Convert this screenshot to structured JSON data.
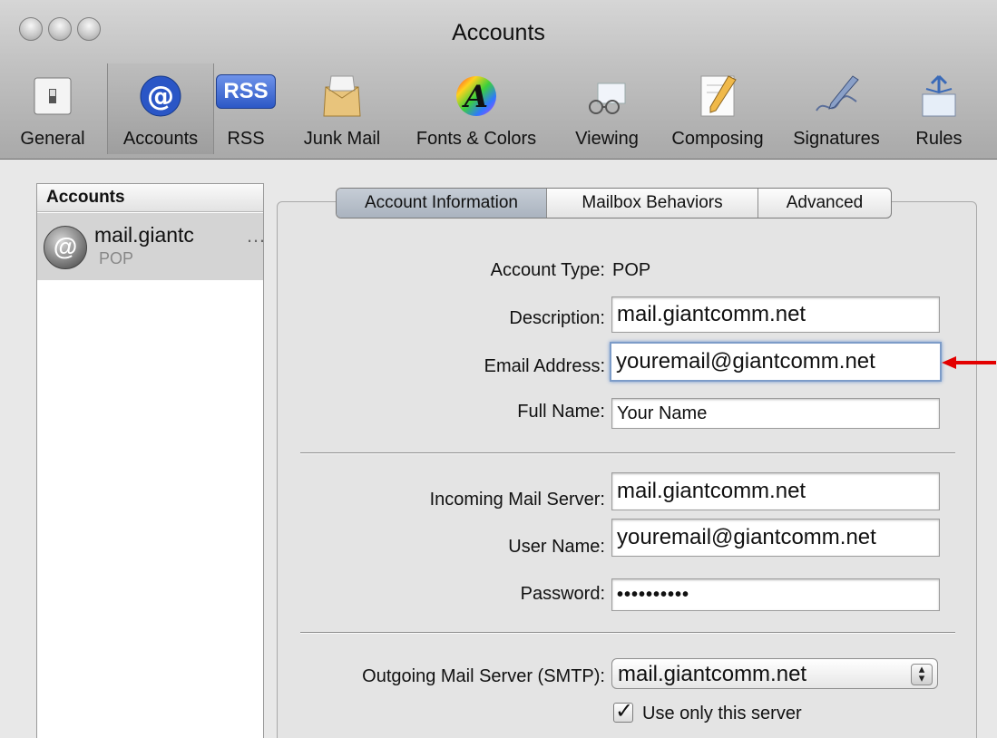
{
  "window": {
    "title": "Accounts"
  },
  "toolbar": {
    "items": [
      {
        "label": "General",
        "icon": "switch-icon"
      },
      {
        "label": "Accounts",
        "icon": "at-icon"
      },
      {
        "label": "RSS",
        "icon": "rss-icon"
      },
      {
        "label": "Junk Mail",
        "icon": "junk-mail-icon"
      },
      {
        "label": "Fonts & Colors",
        "icon": "fonts-colors-icon"
      },
      {
        "label": "Viewing",
        "icon": "viewing-icon"
      },
      {
        "label": "Composing",
        "icon": "composing-icon"
      },
      {
        "label": "Signatures",
        "icon": "signatures-icon"
      },
      {
        "label": "Rules",
        "icon": "rules-icon"
      }
    ],
    "selected": "Accounts",
    "rss_badge": "RSS"
  },
  "sidebar": {
    "header": "Accounts",
    "account_name": "mail.giantc",
    "account_ellipsis": "…",
    "account_type": "POP",
    "avatar_glyph": "@"
  },
  "tabs": [
    "Account Information",
    "Mailbox Behaviors",
    "Advanced"
  ],
  "form": {
    "account_type_label": "Account Type:",
    "account_type_value": "POP",
    "description_label": "Description:",
    "description_value": "mail.giantcomm.net",
    "email_label": "Email Address:",
    "email_value": "youremail@giantcomm.net",
    "full_name_label": "Full Name:",
    "full_name_value": "Your Name",
    "incoming_label": "Incoming Mail Server:",
    "incoming_value": "mail.giantcomm.net",
    "username_label": "User Name:",
    "username_value": "youremail@giantcomm.net",
    "password_label": "Password:",
    "password_value": "••••••••••",
    "outgoing_label": "Outgoing Mail Server (SMTP):",
    "outgoing_value": "mail.giantcomm.net",
    "use_only_label": "Use only this server"
  },
  "colors": {
    "annotation_arrow": "#e30000",
    "focus_ring": "#7d9cc8"
  }
}
